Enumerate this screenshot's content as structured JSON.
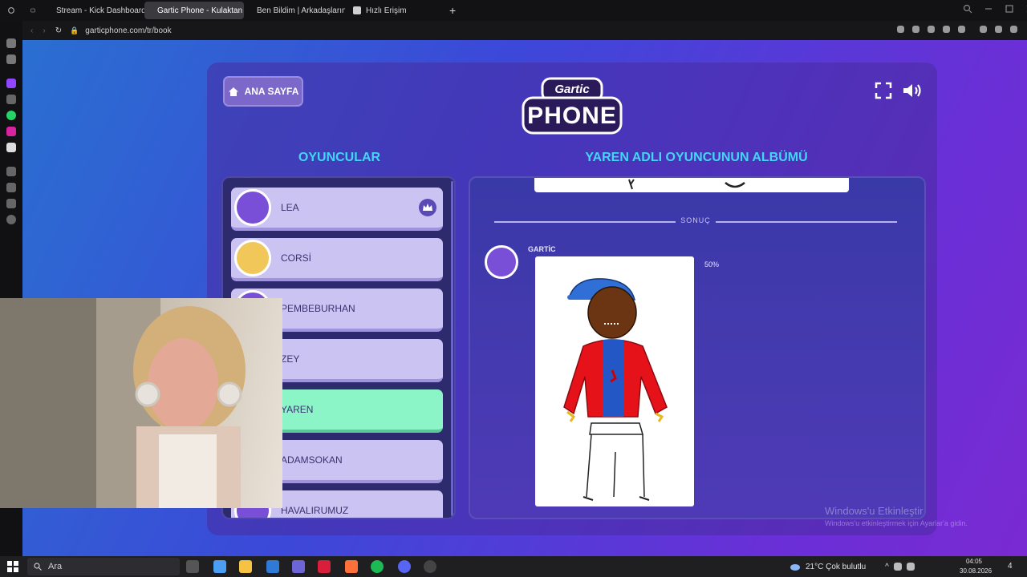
{
  "browser": {
    "tabs": [
      {
        "label": "Stream - Kick Dashboard",
        "icon": "kick-icon",
        "color": "#53fc18"
      },
      {
        "label": "Gartic Phone - Kulaktan K",
        "icon": "gartic-icon",
        "color": "#b38cff"
      },
      {
        "label": "Ben Bildim | Arkadaşlarınla",
        "icon": "benbildim-icon",
        "color": "#e04848"
      },
      {
        "label": "Hızlı Erişim",
        "icon": "grid-icon",
        "color": "#cfcfcf"
      }
    ],
    "url": "garticphone.com/tr/book"
  },
  "game": {
    "home_button": "ANA SAYFA",
    "logo_top": "Gartic",
    "logo_bottom": "PHONE",
    "players_heading": "OYUNCULAR",
    "album_heading": "YAREN ADLI OYUNCUNUN ALBÜMÜ",
    "players": [
      {
        "name": "LEA",
        "avatar_color": "#7a4fd8",
        "host": true
      },
      {
        "name": "CORSİ",
        "avatar_color": "#f2c75a",
        "host": false
      },
      {
        "name": "PEMBEBURHAN",
        "avatar_color": "#7a4fd8",
        "host": false
      },
      {
        "name": "ZEY",
        "avatar_color": "#cbc3f1",
        "host": false
      },
      {
        "name": "YAREN",
        "avatar_color": "#8cf5c8",
        "host": false,
        "active": true
      },
      {
        "name": "ADAMSOKAN",
        "avatar_color": "#cbc3f1",
        "host": false
      },
      {
        "name": "HAVALIRUMUZ",
        "avatar_color": "#7a4fd8",
        "host": false
      }
    ],
    "result_label": "SONUÇ",
    "author": "GARTİC",
    "percent": "50%"
  },
  "watermark": {
    "line1": "Windows'u Etkinleştir",
    "line2": "Windows'u etkinleştirmek için Ayarlar'a gidin."
  },
  "taskbar": {
    "search_placeholder": "Ara",
    "weather": "21°C  Çok bulutlu",
    "time": "04:05",
    "date": "30.08.2026",
    "notifications": "4"
  }
}
